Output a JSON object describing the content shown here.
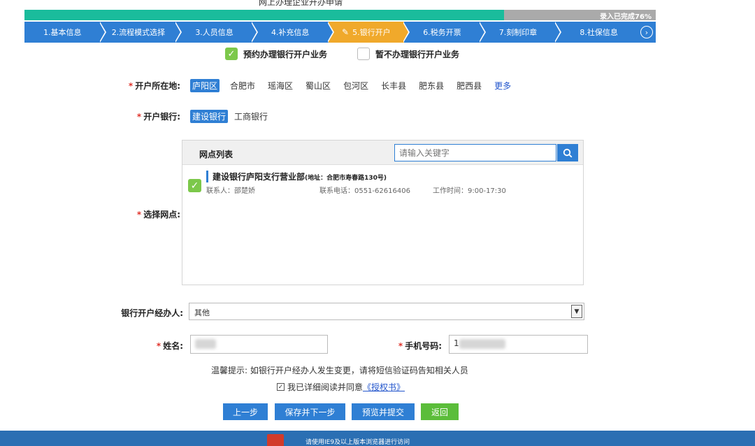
{
  "header": {
    "title": "网上办理企业开办申请"
  },
  "progress": {
    "text": "录入已完成76%",
    "percent": 76
  },
  "steps": [
    {
      "label": "1.基本信息"
    },
    {
      "label": "2.流程模式选择"
    },
    {
      "label": "3.人员信息"
    },
    {
      "label": "4.补充信息"
    },
    {
      "label": "5.银行开户",
      "active": true
    },
    {
      "label": "6.税务开票"
    },
    {
      "label": "7.刻制印章"
    },
    {
      "label": "8.社保信息"
    }
  ],
  "choices": {
    "book": "预约办理银行开户业务",
    "skip": "暂不办理银行开户业务"
  },
  "location": {
    "label": "开户所在地:",
    "options": [
      "庐阳区",
      "合肥市",
      "瑶海区",
      "蜀山区",
      "包河区",
      "长丰县",
      "肥东县",
      "肥西县"
    ],
    "selected": "庐阳区",
    "more": "更多"
  },
  "bank": {
    "label": "开户银行:",
    "options": [
      "建设银行",
      "工商银行"
    ],
    "selected": "建设银行"
  },
  "outlets": {
    "label": "选择网点:",
    "title": "网点列表",
    "search_placeholder": "请输入关键字",
    "items": [
      {
        "name": "建设银行庐阳支行营业部",
        "address": "(地址：合肥市寿春路130号)",
        "contact": "联系人：邵楚娇",
        "phone": "联系电话：0551-62616406",
        "hours": "工作时间：9:00-17:30"
      }
    ]
  },
  "handler": {
    "label": "银行开户经办人:",
    "value": "其他"
  },
  "name_field": {
    "label": "姓名:"
  },
  "phone_field": {
    "label": "手机号码:",
    "value": "1"
  },
  "hint": "温馨提示: 如银行开户经办人发生变更，请将短信验证码告知相关人员",
  "agree": {
    "text": "我已详细阅读并同意",
    "link": "《授权书》"
  },
  "buttons": {
    "prev": "上一步",
    "save_next": "保存并下一步",
    "preview_submit": "预览并提交",
    "back": "返回"
  },
  "footer": {
    "text": "请使用IE9及以上版本浏览器进行访问"
  },
  "colors": {
    "primary": "#2f7fd4",
    "active_step": "#f0a92b",
    "progress": "#1abc9c",
    "green": "#5bbd3a"
  }
}
